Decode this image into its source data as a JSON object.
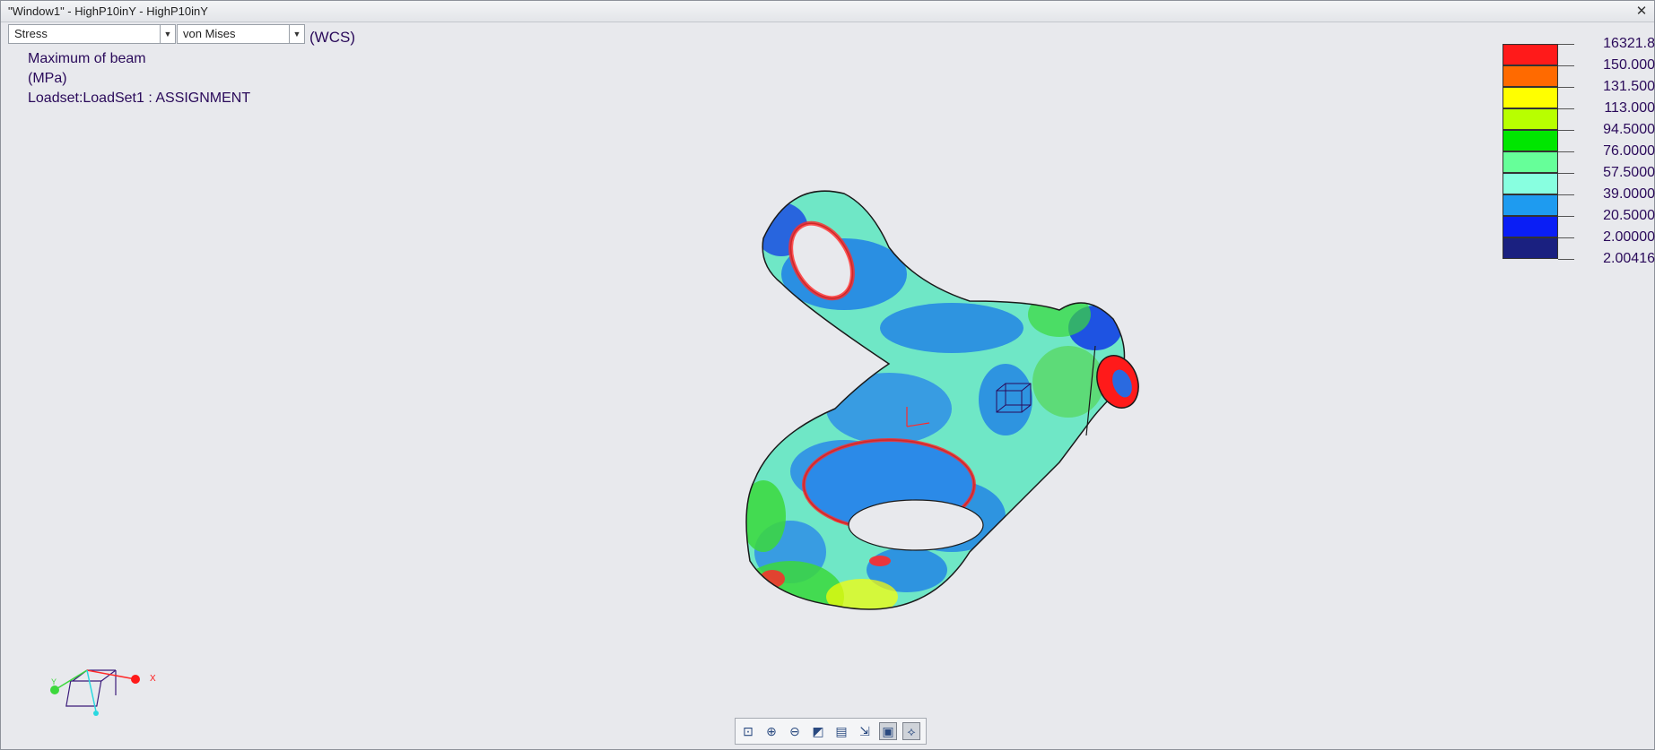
{
  "window": {
    "title": "\"Window1\" - HighP10inY - HighP10inY",
    "close_glyph": "✕"
  },
  "result_type": {
    "selected": "Stress"
  },
  "component": {
    "selected": "von Mises"
  },
  "coordinate_system": "(WCS)",
  "info": {
    "line1": "Maximum of beam",
    "line2": "(MPa)",
    "line3": "Loadset:LoadSet1 :   ASSIGNMENT"
  },
  "legend": {
    "colors": [
      "#ff1a1a",
      "#ff6a00",
      "#ffff00",
      "#b8ff00",
      "#00e600",
      "#66ff99",
      "#88ffe0",
      "#1e9bf0",
      "#0a1ef5",
      "#1a2080"
    ],
    "labels": [
      "16321.8",
      "150.000",
      "131.500",
      "113.000",
      "94.5000",
      "76.0000",
      "57.5000",
      "39.0000",
      "20.5000",
      "2.00000",
      "2.00416"
    ]
  },
  "triad": {
    "x_label": "X",
    "y_label": "Y"
  },
  "toolbar": {
    "buttons": [
      {
        "name": "refit-button",
        "icon": "refit-icon",
        "glyph": "⊡"
      },
      {
        "name": "zoom-in-button",
        "icon": "zoom-in-icon",
        "glyph": "⊕"
      },
      {
        "name": "zoom-out-button",
        "icon": "zoom-out-icon",
        "glyph": "⊖"
      },
      {
        "name": "display-style-button",
        "icon": "display-style-icon",
        "glyph": "◩"
      },
      {
        "name": "saved-views-button",
        "icon": "saved-views-icon",
        "glyph": "▤"
      },
      {
        "name": "view-manager-button",
        "icon": "view-manager-icon",
        "glyph": "⇲"
      },
      {
        "name": "annotation-display-button",
        "icon": "annotation-display-icon",
        "glyph": "▣"
      },
      {
        "name": "datum-display-button",
        "icon": "datum-display-icon",
        "glyph": "⟡"
      }
    ]
  }
}
